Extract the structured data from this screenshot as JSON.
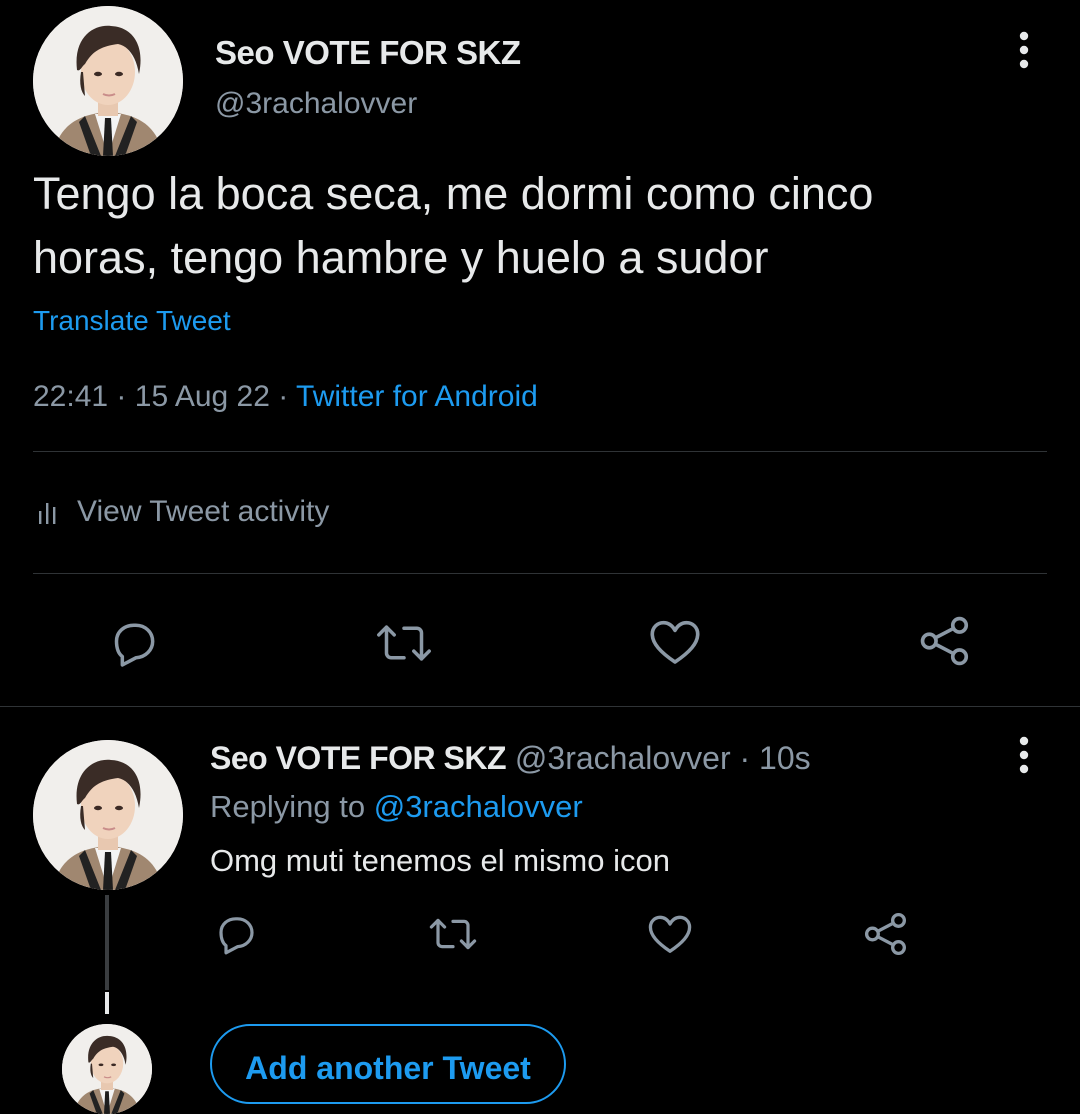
{
  "main_tweet": {
    "display_name": "Seo VOTE FOR SKZ",
    "handle": "@3rachalovver",
    "text": "Tengo la boca seca, me dormi como cinco horas, tengo hambre y huelo a sudor",
    "translate_label": "Translate Tweet",
    "time": "22:41",
    "date": "15 Aug 22",
    "separator": "·",
    "source": "Twitter for Android",
    "activity_label": "View Tweet activity",
    "actions": [
      "reply-icon",
      "retweet-icon",
      "like-icon",
      "share-icon"
    ]
  },
  "reply_tweet": {
    "display_name": "Seo VOTE FOR SKZ",
    "handle": "@3rachalovver",
    "time_ago": "· 10s",
    "replying_prefix": "Replying to",
    "replying_to": "@3rachalovver",
    "text": "Omg muti tenemos el mismo icon",
    "actions": [
      "reply-icon",
      "retweet-icon",
      "like-icon",
      "share-icon"
    ]
  },
  "composer": {
    "add_button_label": "Add another Tweet"
  },
  "colors": {
    "background": "#000000",
    "text": "#e7e9ea",
    "muted": "#8b98a5",
    "accent": "#1d9bf0",
    "divider": "#2f3336"
  }
}
